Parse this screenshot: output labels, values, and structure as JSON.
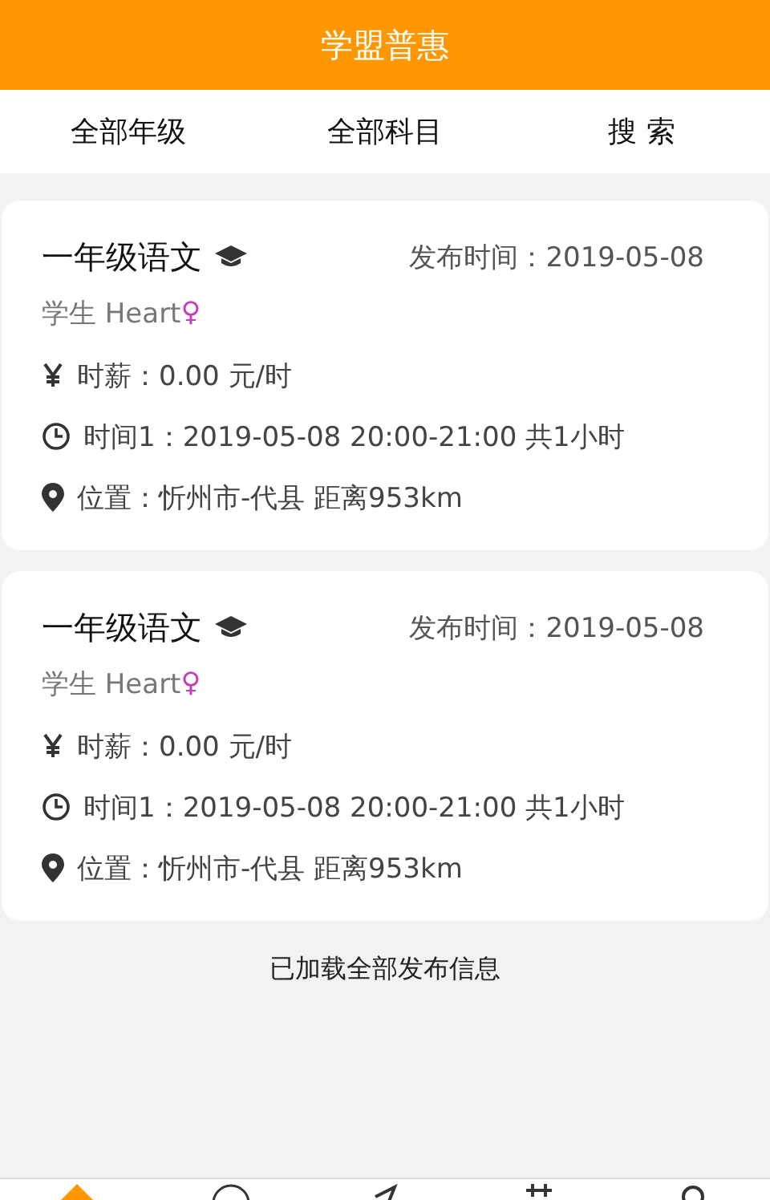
{
  "header": {
    "title": "学盟普惠"
  },
  "filters": [
    {
      "label": "全部年级"
    },
    {
      "label": "全部科目"
    },
    {
      "label": "搜 索"
    }
  ],
  "posts": [
    {
      "subject": "一年级语文",
      "published": "发布时间：2019-05-08",
      "student": "学生 Heart",
      "gender_symbol": "♀",
      "salary": "时薪：0.00 元/时",
      "schedule": "时间1：2019-05-08 20:00-21:00 共1小时",
      "location": "位置：忻州市-代县 距离953km"
    },
    {
      "subject": "一年级语文",
      "published": "发布时间：2019-05-08",
      "student": "学生 Heart",
      "gender_symbol": "♀",
      "salary": "时薪：0.00 元/时",
      "schedule": "时间1：2019-05-08 20:00-21:00 共1小时",
      "location": "位置：忻州市-代县 距离953km"
    }
  ],
  "footer_note": "已加载全部发布信息",
  "tab_bar": [
    {
      "selected": true
    },
    {
      "selected": false
    },
    {
      "selected": false
    },
    {
      "selected": false
    },
    {
      "selected": false
    }
  ]
}
